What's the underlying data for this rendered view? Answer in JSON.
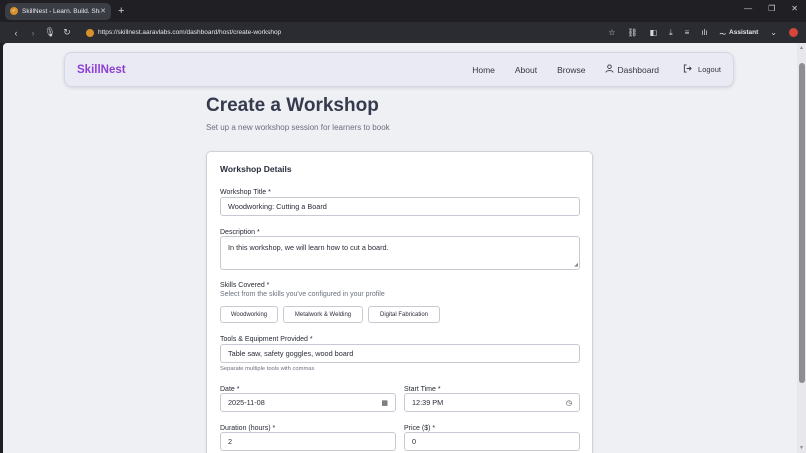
{
  "browser": {
    "tab_title": "SkillNest - Learn. Build. Share.",
    "url": "https://skillnest.aaravlabs.com/dashboard/host/create-workshop",
    "assistant_label": "Assistant"
  },
  "site": {
    "logo": "SkillNest",
    "nav": {
      "home": "Home",
      "about": "About",
      "browse": "Browse",
      "dashboard": "Dashboard",
      "logout": "Logout"
    }
  },
  "page": {
    "title": "Create a Workshop",
    "subtitle": "Set up a new workshop session for learners to book"
  },
  "form": {
    "section_title": "Workshop Details",
    "workshop_title": {
      "label": "Workshop Title *",
      "value": "Woodworking: Cutting a Board"
    },
    "description": {
      "label": "Description *",
      "value": "In this workshop, we will learn how to cut a board."
    },
    "skills": {
      "label": "Skills Covered *",
      "hint": "Select from the skills you've configured in your profile",
      "options": [
        "Woodworking",
        "Metalwork & Welding",
        "Digital Fabrication"
      ]
    },
    "tools": {
      "label": "Tools & Equipment Provided *",
      "value": "Table saw, safety goggles, wood board",
      "hint": "Separate multiple tools with commas"
    },
    "date": {
      "label": "Date *",
      "value": "2025-11-08"
    },
    "start_time": {
      "label": "Start Time *",
      "value": "12:39 PM"
    },
    "duration": {
      "label": "Duration (hours) *",
      "value": "2"
    },
    "price": {
      "label": "Price ($) *",
      "value": "0"
    }
  }
}
